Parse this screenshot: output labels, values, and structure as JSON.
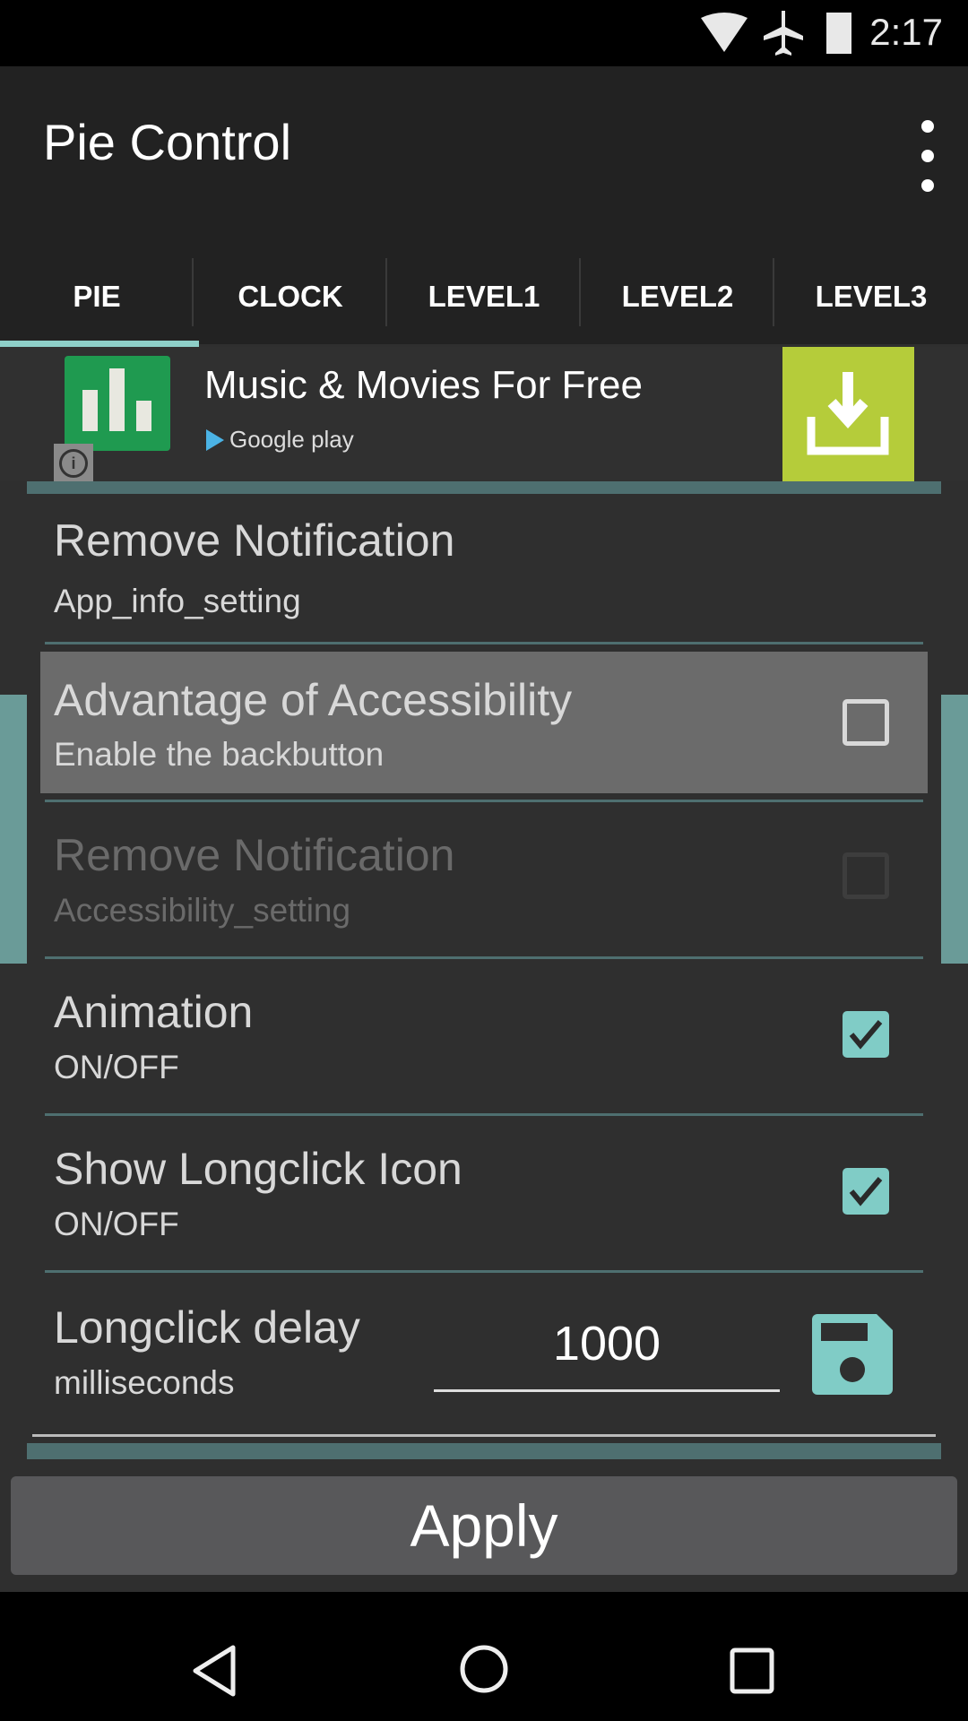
{
  "status_bar": {
    "time": "2:17",
    "icons": [
      "wifi-icon",
      "airplane-icon",
      "battery-icon"
    ]
  },
  "app_bar": {
    "title": "Pie Control",
    "menu_icon": "overflow-menu-icon"
  },
  "tabs": [
    {
      "label": "PIE",
      "active": true
    },
    {
      "label": "CLOCK",
      "active": false
    },
    {
      "label": "LEVEL1",
      "active": false
    },
    {
      "label": "LEVEL2",
      "active": false
    },
    {
      "label": "LEVEL3",
      "active": false
    }
  ],
  "ad": {
    "title": "Music & Movies For Free",
    "store": "Google play",
    "info_glyph": "i"
  },
  "settings": [
    {
      "title": "Remove Notification",
      "subtitle": "App_info_setting",
      "checkbox": null,
      "enabled": true
    },
    {
      "title": "Advantage of Accessibility",
      "subtitle": "Enable the backbutton",
      "checkbox": false,
      "enabled": true,
      "highlighted": true
    },
    {
      "title": "Remove Notification",
      "subtitle": "Accessibility_setting",
      "checkbox": false,
      "enabled": false
    },
    {
      "title": "Animation",
      "subtitle": "ON/OFF",
      "checkbox": true,
      "enabled": true
    },
    {
      "title": "Show Longclick Icon",
      "subtitle": "ON/OFF",
      "checkbox": true,
      "enabled": true
    }
  ],
  "longclick": {
    "title": "Longclick delay",
    "subtitle": "milliseconds",
    "value": "1000"
  },
  "apply_label": "Apply",
  "colors": {
    "accent": "#80ccc6",
    "ad_button": "#b5cc3a",
    "divider": "#4e6f70"
  }
}
